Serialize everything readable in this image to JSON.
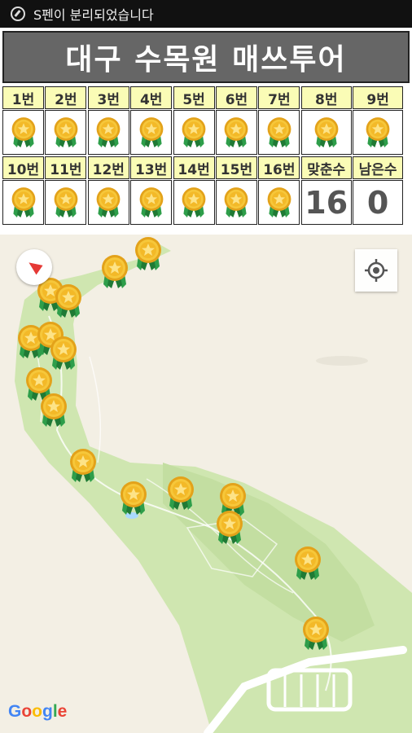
{
  "status_bar": {
    "message": "S펜이 분리되었습니다"
  },
  "app": {
    "title": "대구 수목원 매쓰투어"
  },
  "grid": {
    "row1_labels": [
      "1번",
      "2번",
      "3번",
      "4번",
      "5번",
      "6번",
      "7번",
      "8번",
      "9번"
    ],
    "row2_labels": [
      "10번",
      "11번",
      "12번",
      "13번",
      "14번",
      "15번",
      "16번"
    ],
    "matched_label": "맞춘수",
    "remaining_label": "남은수",
    "matched_count": "16",
    "remaining_count": "0"
  },
  "map": {
    "google_logo": {
      "G": "G",
      "o1": "o",
      "o2": "o",
      "g": "g",
      "l": "l",
      "e": "e"
    },
    "colors": {
      "park": "#cfe6b0",
      "land": "#f3efe4",
      "path": "#ffffff",
      "water": "#aadaff",
      "g_blue": "#4285f4",
      "g_red": "#ea4335",
      "g_yellow": "#fbbc05",
      "g_green": "#34a853"
    }
  }
}
